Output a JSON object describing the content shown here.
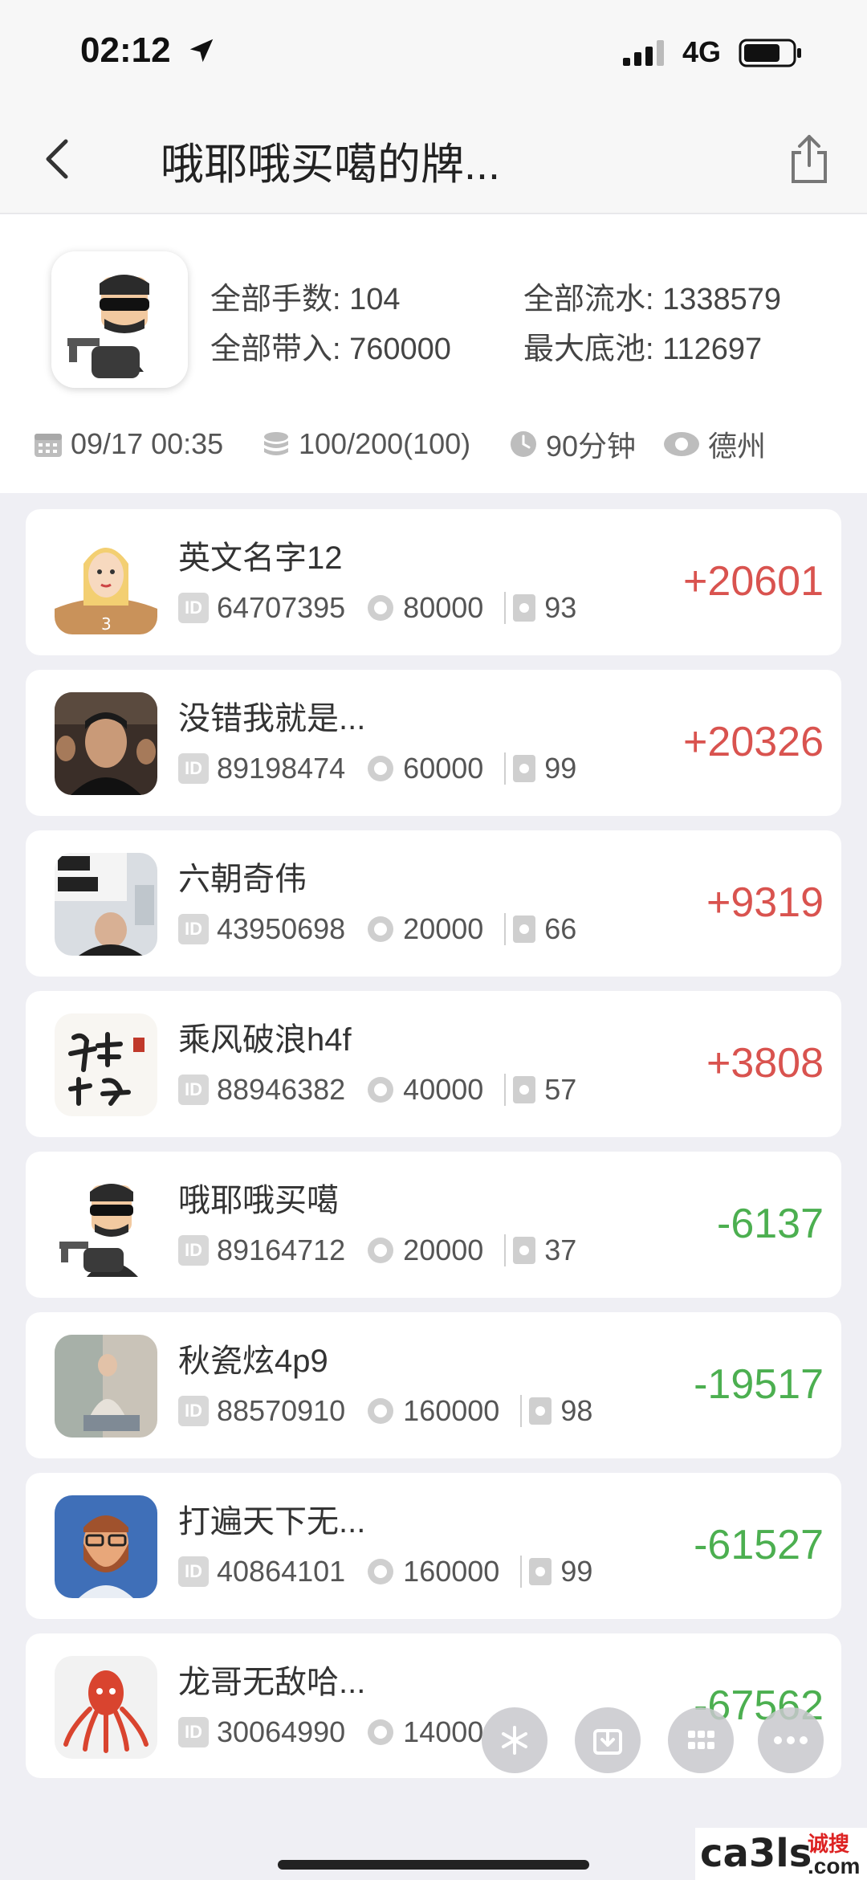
{
  "status_bar": {
    "time": "02:12",
    "network": "4G"
  },
  "nav": {
    "title": "哦耶哦买噶的牌..."
  },
  "summary": {
    "total_hands_label": "全部手数:",
    "total_hands": "104",
    "total_flow_label": "全部流水:",
    "total_flow": "1338579",
    "total_buyin_label": "全部带入:",
    "total_buyin": "760000",
    "max_pot_label": "最大底池:",
    "max_pot": "112697",
    "date": "09/17 00:35",
    "blinds": "100/200(100)",
    "duration": "90分钟",
    "game": "德州"
  },
  "players": [
    {
      "name": "英文名字12",
      "id": "64707395",
      "buyin": "80000",
      "hands": "93",
      "score": "+20601",
      "result": "win",
      "avatar": "girl-avatar"
    },
    {
      "name": "没错我就是...",
      "id": "89198474",
      "buyin": "60000",
      "hands": "99",
      "score": "+20326",
      "result": "win",
      "avatar": "movie-photo-avatar"
    },
    {
      "name": "六朝奇伟",
      "id": "43950698",
      "buyin": "20000",
      "hands": "66",
      "score": "+9319",
      "result": "win",
      "avatar": "sign-photo-avatar"
    },
    {
      "name": "乘风破浪h4f",
      "id": "88946382",
      "buyin": "40000",
      "hands": "57",
      "score": "+3808",
      "result": "win",
      "avatar": "calligraphy-avatar"
    },
    {
      "name": "哦耶哦买噶",
      "id": "89164712",
      "buyin": "20000",
      "hands": "37",
      "score": "-6137",
      "result": "loss",
      "avatar": "gangster-avatar"
    },
    {
      "name": "秋瓷炫4p9",
      "id": "88570910",
      "buyin": "160000",
      "hands": "98",
      "score": "-19517",
      "result": "loss",
      "avatar": "photo-avatar"
    },
    {
      "name": "打遍天下无...",
      "id": "40864101",
      "buyin": "160000",
      "hands": "99",
      "score": "-61527",
      "result": "loss",
      "avatar": "bearded-man-avatar"
    },
    {
      "name": "龙哥无敌哈...",
      "id": "30064990",
      "buyin": "14000",
      "hands": "",
      "score": "-67562",
      "result": "loss",
      "avatar": "octopus-avatar"
    }
  ],
  "watermark": {
    "text": "ca3ls",
    "cn": "诚搜",
    "suffix": ".com"
  },
  "colors": {
    "win": "#d9534f",
    "loss": "#4caf50"
  }
}
